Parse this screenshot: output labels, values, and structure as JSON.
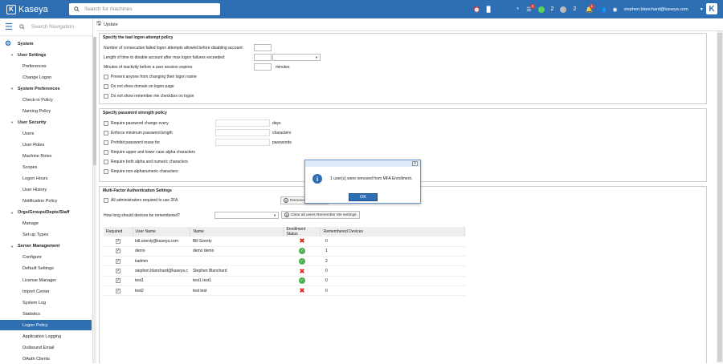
{
  "header": {
    "logo_text": "Kaseya",
    "search_placeholder": "Search for machines",
    "green_count": "2",
    "grey_count": "2",
    "tasks_badge": "3",
    "alerts_badge": "1",
    "user": "stephen.blanchard@kaseya.com"
  },
  "sidebar": {
    "search_placeholder": "Search Navigation",
    "top": "System",
    "items": [
      {
        "label": "User Settings",
        "level": 1
      },
      {
        "label": "Preferences",
        "level": 2
      },
      {
        "label": "Change Logon",
        "level": 2
      },
      {
        "label": "System Preferences",
        "level": 1
      },
      {
        "label": "Check-in Policy",
        "level": 2
      },
      {
        "label": "Naming Policy",
        "level": 2
      },
      {
        "label": "User Security",
        "level": 1
      },
      {
        "label": "Users",
        "level": 2
      },
      {
        "label": "User Roles",
        "level": 2
      },
      {
        "label": "Machine Roles",
        "level": 2
      },
      {
        "label": "Scopes",
        "level": 2
      },
      {
        "label": "Logon Hours",
        "level": 2
      },
      {
        "label": "User History",
        "level": 2
      },
      {
        "label": "Notification Policy",
        "level": 2
      },
      {
        "label": "Orgs/Groups/Depts/Staff",
        "level": 1
      },
      {
        "label": "Manage",
        "level": 2
      },
      {
        "label": "Set-up Types",
        "level": 2
      },
      {
        "label": "Server Management",
        "level": 1
      },
      {
        "label": "Configure",
        "level": 2
      },
      {
        "label": "Default Settings",
        "level": 2
      },
      {
        "label": "License Manager",
        "level": 2
      },
      {
        "label": "Import Center",
        "level": 2
      },
      {
        "label": "System Log",
        "level": 2
      },
      {
        "label": "Statistics",
        "level": 2
      },
      {
        "label": "Logon Policy",
        "level": 2,
        "active": true
      },
      {
        "label": "Application Logging",
        "level": 2
      },
      {
        "label": "Outbound Email",
        "level": 2
      },
      {
        "label": "OAuth Clients",
        "level": 2
      }
    ]
  },
  "toolbar": {
    "update_label": "Update"
  },
  "logon": {
    "title": "Specify the bad logon attempt policy",
    "failed_label": "Number of consecutive failed logon attempts allowed before disabling account:",
    "length_label": "Length of time to disable account after max logon failures exceeded:",
    "inactivity_label": "Minutes of inactivity before a user session expires",
    "minutes": "minutes",
    "prevent": "Prevent anyone from changing their logon name",
    "no_domain": "Do not show domain on logon page",
    "no_remember": "Do not show remember me checkbox on logon"
  },
  "password": {
    "title": "Specify password strength policy",
    "change": "Require password change every",
    "days": "days",
    "min_len": "Enforce minimum password length",
    "characters": "characters",
    "reuse": "Prohibit password reuse for",
    "passwords": "passwords",
    "upper": "Require upper and lower case alpha characters",
    "alnum": "Require both alpha and numeric characters",
    "nonalpha": "Require non-alphanumeric characters"
  },
  "mfa": {
    "title": "Multi-Factor Authentication Settings",
    "require_2fa": "All administrators required to use 2FA",
    "remove_btn": "Remove",
    "remember_q": "How long should devices be remembered?",
    "clear_btn": "Clear all users Remember Me settings",
    "columns": [
      "Required",
      "User Name",
      "Name",
      "Enrollment Status",
      "Remembered Devices"
    ],
    "rows": [
      {
        "user": "bill.szerdy@kaseya.com",
        "name": "Bill Szerdy",
        "status": "x",
        "devices": "0"
      },
      {
        "user": "demo",
        "name": "demo demo",
        "status": "ok",
        "devices": "1"
      },
      {
        "user": "kadmin",
        "name": "",
        "status": "ok",
        "devices": "2"
      },
      {
        "user": "stephen.blanchard@kaseya.c",
        "name": "Stephen Blanchard",
        "status": "x",
        "devices": "0"
      },
      {
        "user": "test1",
        "name": "test1 test1",
        "status": "ok",
        "devices": "0"
      },
      {
        "user": "test2",
        "name": "test test",
        "status": "x",
        "devices": "0"
      }
    ]
  },
  "modal": {
    "message": "1 user(s) were removed from MFA Enrollment.",
    "ok_label": "OK"
  }
}
